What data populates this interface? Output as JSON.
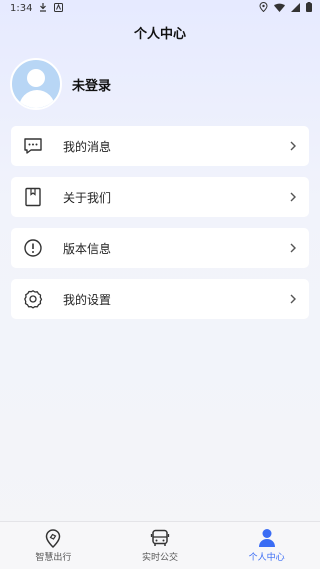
{
  "status_bar": {
    "time": "1:34",
    "left_icons": [
      "download-icon",
      "notification-app-icon"
    ],
    "right_icons": [
      "location-icon",
      "wifi-icon",
      "signal-icon",
      "battery-icon"
    ]
  },
  "header": {
    "title": "个人中心"
  },
  "profile": {
    "name": "未登录"
  },
  "menu": {
    "items": [
      {
        "label": "我的消息",
        "icon": "message-icon"
      },
      {
        "label": "关于我们",
        "icon": "book-icon"
      },
      {
        "label": "版本信息",
        "icon": "info-icon"
      },
      {
        "label": "我的设置",
        "icon": "gear-icon"
      }
    ]
  },
  "tabs": {
    "items": [
      {
        "label": "智慧出行",
        "icon": "map-pin-icon",
        "active": false
      },
      {
        "label": "实时公交",
        "icon": "bus-icon",
        "active": false
      },
      {
        "label": "个人中心",
        "icon": "person-icon",
        "active": true
      }
    ]
  },
  "colors": {
    "accent": "#3a6cf4",
    "avatar_bg": "#b8d6f5"
  }
}
